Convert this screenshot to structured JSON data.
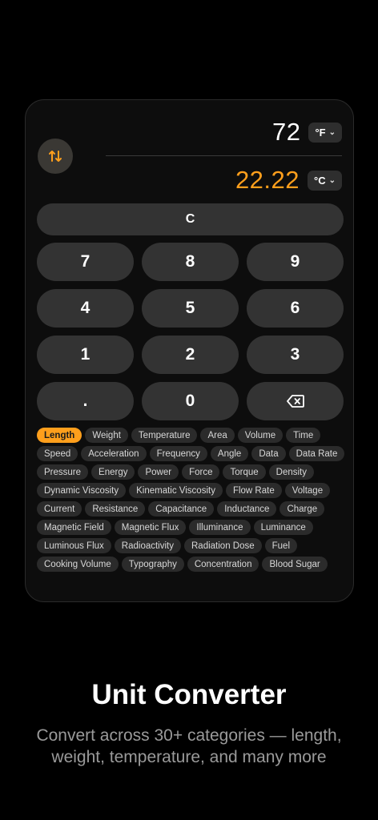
{
  "converter": {
    "from_value": "72",
    "from_unit": "°F",
    "to_value": "22.22",
    "to_unit": "°C"
  },
  "keypad": {
    "clear_label": "C",
    "keys": [
      "7",
      "8",
      "9",
      "4",
      "5",
      "6",
      "1",
      "2",
      "3",
      ".",
      "0"
    ],
    "backspace_icon": "backspace-icon"
  },
  "categories": {
    "active": "Length",
    "items": [
      "Length",
      "Weight",
      "Temperature",
      "Area",
      "Volume",
      "Time",
      "Speed",
      "Acceleration",
      "Frequency",
      "Angle",
      "Data",
      "Data Rate",
      "Pressure",
      "Energy",
      "Power",
      "Force",
      "Torque",
      "Density",
      "Dynamic Viscosity",
      "Kinematic Viscosity",
      "Flow Rate",
      "Voltage",
      "Current",
      "Resistance",
      "Capacitance",
      "Inductance",
      "Charge",
      "Magnetic Field",
      "Magnetic Flux",
      "Illuminance",
      "Luminance",
      "Luminous Flux",
      "Radioactivity",
      "Radiation Dose",
      "Fuel",
      "Cooking Volume",
      "Typography",
      "Concentration",
      "Blood Sugar"
    ]
  },
  "promo": {
    "title": "Unit Converter",
    "subtitle": "Convert across 30+ categories — length, weight, temperature, and many more"
  },
  "colors": {
    "accent": "#ff9f1c",
    "background": "#000000",
    "key": "#333333"
  }
}
